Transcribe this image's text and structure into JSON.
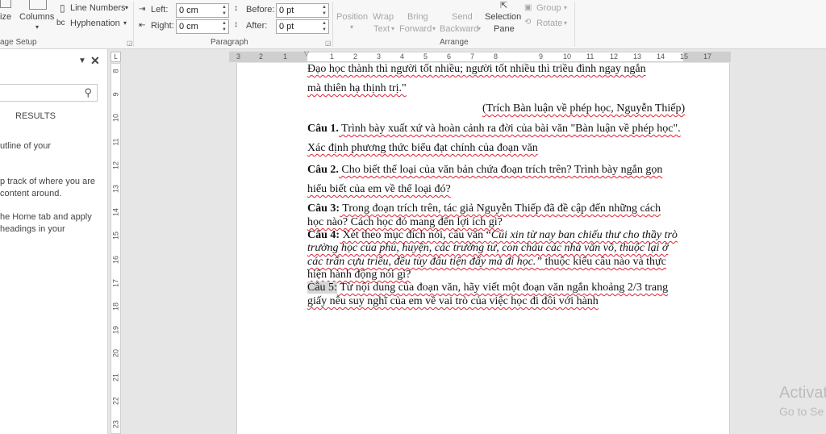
{
  "ribbon": {
    "size_label": "ize",
    "columns_label": "Columns",
    "line_numbers_label": "Line Numbers",
    "hyphenation_label": "Hyphenation",
    "page_setup_label": "age Setup",
    "indent_left_label": "Left:",
    "indent_left_value": "0 cm",
    "indent_right_label": "Right:",
    "indent_right_value": "0 cm",
    "spacing_before_label": "Before:",
    "spacing_before_value": "0 pt",
    "spacing_after_label": "After:",
    "spacing_after_value": "0 pt",
    "paragraph_label": "Paragraph",
    "position_label": "Position",
    "wrap_text_label_1": "Wrap",
    "wrap_text_label_2": "Text",
    "bring_forward_label_1": "Bring",
    "bring_forward_label_2": "Forward",
    "send_backward_label_1": "Send",
    "send_backward_label_2": "Backward",
    "selection_pane_label_1": "Selection",
    "selection_pane_label_2": "Pane",
    "group_label": "Group",
    "rotate_label": "Rotate",
    "arrange_label": "Arrange"
  },
  "nav": {
    "tab_results": "RESULTS",
    "text_1": "utline of your",
    "text_2": "p track of where you are",
    "text_3": "content around.",
    "text_4": "he Home tab and apply",
    "text_5": "headings in your"
  },
  "ruler": {
    "h_ticks": [
      "3",
      "2",
      "1",
      "1",
      "2",
      "3",
      "4",
      "5",
      "6",
      "7",
      "8",
      "9",
      "10",
      "11",
      "12",
      "13",
      "14",
      "15",
      "17"
    ],
    "v_ticks": [
      "8",
      "9",
      "10",
      "11",
      "12",
      "13",
      "14",
      "15",
      "16",
      "17",
      "18",
      "19",
      "20",
      "21",
      "22",
      "23"
    ]
  },
  "doc": {
    "l1": "Đạo học thành thì người tốt nhiều; người tốt nhiều thì triều đình ngay ngắn",
    "l2": "mà thiên hạ thịnh trị.\"",
    "citation": "(Trích Bàn luận về phép học, Nguyễn Thiếp)",
    "q1_label": "Câu 1.",
    "q1_a": " Trình bày xuất xứ và hoàn cảnh ra đời của bài văn \"Bàn luận về phép học\".",
    "q1_b": "Xác định phương thức biểu đạt chính của đoạn văn",
    "q2_label": "Câu 2.",
    "q2_a": " Cho biết thể loại của văn bản chứa đoạn trích trên? Trình bày ngắn gọn",
    "q2_b": "hiểu biết của em về thể loại đó?",
    "q3_label": "Câu 3:",
    "q3_a": " Trong đoạn trích trên, tác giả Nguyễn Thiếp đã đề cập đến những cách",
    "q3_b": "học nào? Cách học đó mang đến lợi ích gì?",
    "q4_label": "Câu 4:",
    "q4_a": " Xét theo mục đích nói, câu văn “",
    "q4_a_i": "Cúi xin từ nay ban chiếu thư cho thầy trò",
    "q4_b_i": "trường học của phủ, huyện, các trường tư, con cháu các nhà văn võ, thuộc lại ở",
    "q4_c_i": "các trấn cựu triều, đều tùy đâu tiện đấy mà đi học.”",
    "q4_c": " thuộc kiểu câu nào và thực",
    "q4_d": "hiện hành động nói gì?",
    "q5_label": "Câu 5:",
    "q5_a": " Từ nội dung của đoạn văn, hãy viết một đoạn văn ngắn khoảng 2/3 trang",
    "q5_b": "giấy nêu suy nghĩ của em về vai trò của việc học đi đôi với hành"
  },
  "watermark": {
    "line1": "Activat",
    "line2": "Go to Se"
  }
}
